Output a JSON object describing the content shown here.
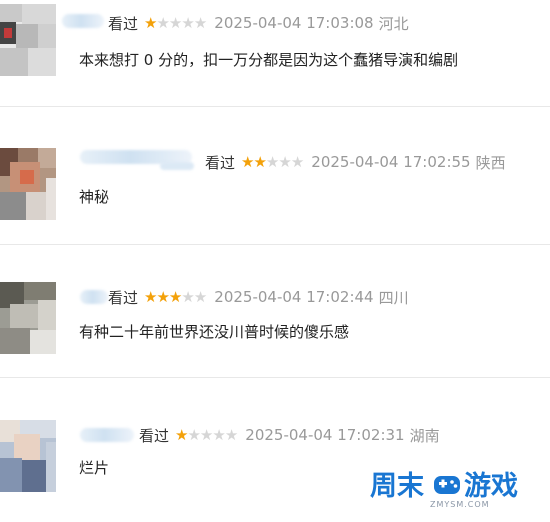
{
  "reviews": [
    {
      "status": "看过",
      "rating": 1,
      "max_rating": 5,
      "date": "2025-04-04 17:03:08",
      "location": "河北",
      "content": "本来想打 0 分的，扣一万分都是因为这个蠢猪导演和编剧"
    },
    {
      "status": "看过",
      "rating": 2,
      "max_rating": 5,
      "date": "2025-04-04 17:02:55",
      "location": "陕西",
      "content": "神秘"
    },
    {
      "status": "看过",
      "rating": 3,
      "max_rating": 5,
      "date": "2025-04-04 17:02:44",
      "location": "四川",
      "content": "有种二十年前世界还没川普时候的傻乐感"
    },
    {
      "status": "看过",
      "rating": 1,
      "max_rating": 5,
      "date": "2025-04-04 17:02:31",
      "location": "湖南",
      "content": "烂片"
    }
  ],
  "icons": {
    "star_filled": "star-icon",
    "star_empty": "star-empty-icon"
  },
  "colors": {
    "star": "#f3a10a",
    "meta": "#999999",
    "text": "#222222",
    "watermark": "#1976d2"
  },
  "watermark": {
    "brand_a": "周末",
    "brand_b": "游戏",
    "site": "ZMYSM.COM"
  }
}
